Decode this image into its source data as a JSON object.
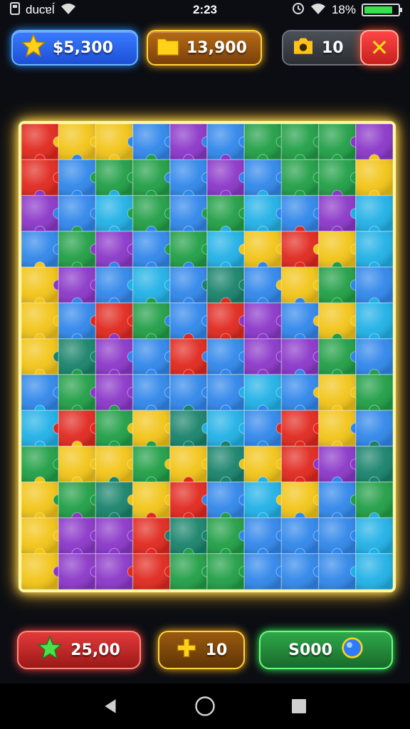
{
  "status_bar": {
    "left_text": "ducɐĺ",
    "time": "2:23",
    "battery_text": "18%",
    "battery_level": 0.85,
    "icons": [
      "sim-icon",
      "wifi-icon",
      "alarm-icon",
      "wifi-icon",
      "battery-icon"
    ]
  },
  "hud_top": {
    "coins": {
      "icon": "star-icon",
      "value": "$5,300"
    },
    "folders": {
      "icon": "folder-icon",
      "value": "13,900"
    },
    "level": {
      "icon": "camera-icon",
      "value": "10"
    },
    "close": {
      "icon": "close-icon",
      "label": "✕"
    }
  },
  "board": {
    "cols": 10,
    "rows": 13,
    "palette": {
      "R": "#e0271d",
      "Y": "#f2c416",
      "B": "#2f86ea",
      "C": "#1fb0e6",
      "P": "#8a36c8",
      "G": "#1f9e45",
      "T": "#17826a"
    },
    "tiles": [
      "RYYBPBGGGP",
      "RBGGBPBGGY",
      "PBCGBGCBPC",
      "BGPBGCYRYC",
      "YPBCBTBYGB",
      "YBRGBRPBYC",
      "YTPBRBPPGB",
      "BGPBBBCBYG",
      "CRGYTCBRYB",
      "GYYGYTYRPT",
      "YGTYRBCYBG",
      "YPPRTGBBBC",
      "YPPRGGBBBC"
    ]
  },
  "hud_bottom": {
    "score": {
      "icon": "star-icon",
      "value": "25,00"
    },
    "add": {
      "icon": "plus-icon",
      "value": "10"
    },
    "coins": {
      "icon": "coin-icon",
      "value": "S000"
    }
  },
  "nav": {
    "items": [
      "back-icon",
      "home-icon",
      "recents-icon"
    ]
  }
}
